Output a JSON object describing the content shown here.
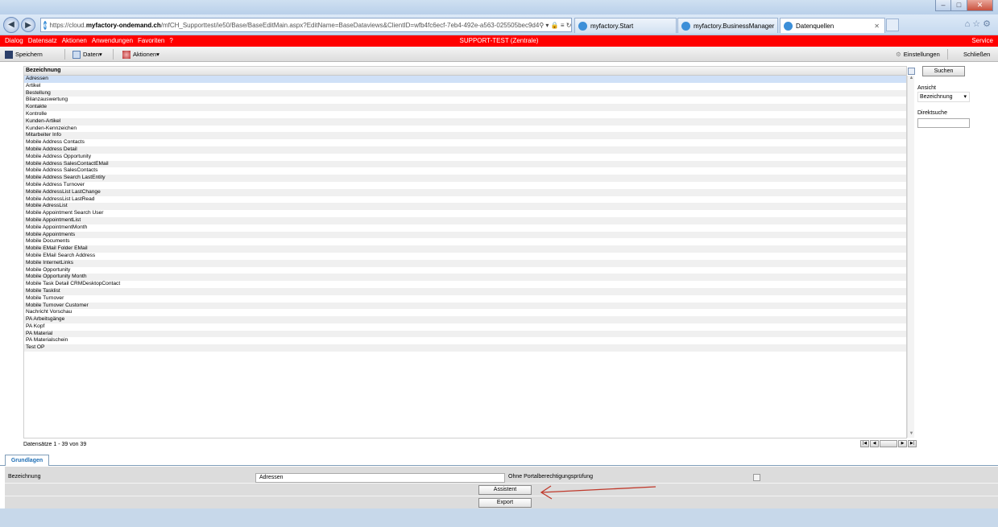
{
  "browser": {
    "url_prefix": "https://cloud.",
    "url_domain": "myfactory-ondemand.ch",
    "url_path": "/mfCH_Supporttest/ie50/Base/BaseEditMain.aspx?EditName=BaseDataviews&ClientID=wfb4fc6ecf-7eb4-492e-a563-025505bec9d4",
    "tabs": [
      {
        "label": "myfactory.Start"
      },
      {
        "label": "myfactory.BusinessManager"
      },
      {
        "label": "Datenquellen"
      }
    ]
  },
  "menu": {
    "items": [
      "Dialog",
      "Datensatz",
      "Aktionen",
      "Anwendungen",
      "Favoriten",
      "?"
    ],
    "center": "SUPPORT-TEST (Zentrale)",
    "right": "Service"
  },
  "toolbar": {
    "save": "Speichern",
    "data": "Daten▾",
    "actions": "Aktionen▾",
    "settings": "Einstellungen",
    "close": "Schließen"
  },
  "list": {
    "header": "Bezeichnung",
    "rows": [
      "Adressen",
      "Artikel",
      "Bestellung",
      "Bilanzauswertung",
      "Kontakte",
      "Kontrolle",
      "Kunden-Artikel",
      "Kunden-Kennzeichen",
      "Mitarbeiter Info",
      "Mobile Address Contacts",
      "Mobile Address Detail",
      "Mobile Address Opportunity",
      "Mobile Address SalesContactEMail",
      "Mobile Address SalesContacts",
      "Mobile Address Search LastEntity",
      "Mobile Address Turnover",
      "Mobile AddressList LastChange",
      "Mobile AddressList LastRead",
      "Mobile AdressList",
      "Mobile Appointment Search User",
      "Mobile AppointmentList",
      "Mobile AppointmentMonth",
      "Mobile Appointments",
      "Mobile Documents",
      "Mobile EMail Folder EMail",
      "Mobile EMail Search Address",
      "Mobile InternetLinks",
      "Mobile Opportunity",
      "Mobile Opportunity Month",
      "Mobile Task Detail CRMDesktopContact",
      "Mobile Tasklist",
      "Mobile Turnover",
      "Mobile Turnover Customer",
      "Nachricht Vorschau",
      "PA Arbeitsgänge",
      "PA Kopf",
      "PA Material",
      "PA Materialschein",
      "Test OP"
    ],
    "records": "Datensätze 1 - 39 von 39"
  },
  "panel": {
    "search_btn": "Suchen",
    "view_label": "Ansicht",
    "view_value": "Bezeichnung",
    "direct_label": "Direktsuche"
  },
  "detail": {
    "tab": "Grundlagen",
    "field_label": "Bezeichnung",
    "field_value": "Adressen",
    "check_label": "Ohne Portalberechtigungsprüfung",
    "assistant": "Assistent",
    "export": "Export"
  },
  "colors": {
    "menu": "#ff0000",
    "arrow": "#c0392b"
  }
}
